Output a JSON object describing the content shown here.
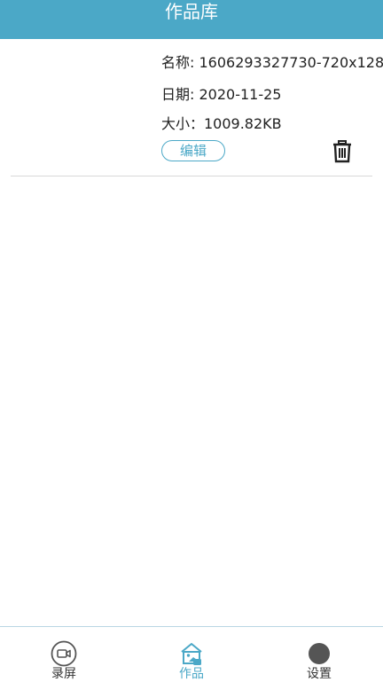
{
  "header": {
    "title": "作品库"
  },
  "work_item": {
    "name": "名称: 1606293327730-720x128",
    "date": "日期: 2020-11-25",
    "size": "大小：1009.82KB",
    "edit_label": "编辑",
    "delete_icon": "trash-icon"
  },
  "tabs": [
    {
      "label": "录屏",
      "icon": "video-camera-icon",
      "active": false
    },
    {
      "label": "作品",
      "icon": "gallery-folder-icon",
      "active": true
    },
    {
      "label": "设置",
      "icon": "settings-dot-icon",
      "active": false
    }
  ],
  "colors": {
    "primary": "#4ba8c7",
    "header_text": "#ffffff",
    "text": "#222222",
    "divider": "#d9d9d9",
    "inactive_icon": "#555555"
  }
}
